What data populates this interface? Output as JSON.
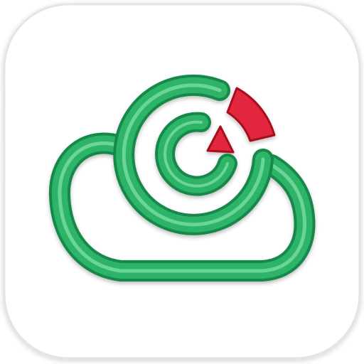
{
  "app_icon": {
    "icon": "cloud-radar-icon",
    "colors": {
      "tile": "#ffffff",
      "tile_border": "#e4e4e4",
      "cloud": "#2fb468",
      "cloud_dark": "#14884a",
      "cloud_highlight": "#7fe0a6",
      "radar_sector": "#e2283c",
      "radar_sector_dark": "#a8101f"
    }
  }
}
